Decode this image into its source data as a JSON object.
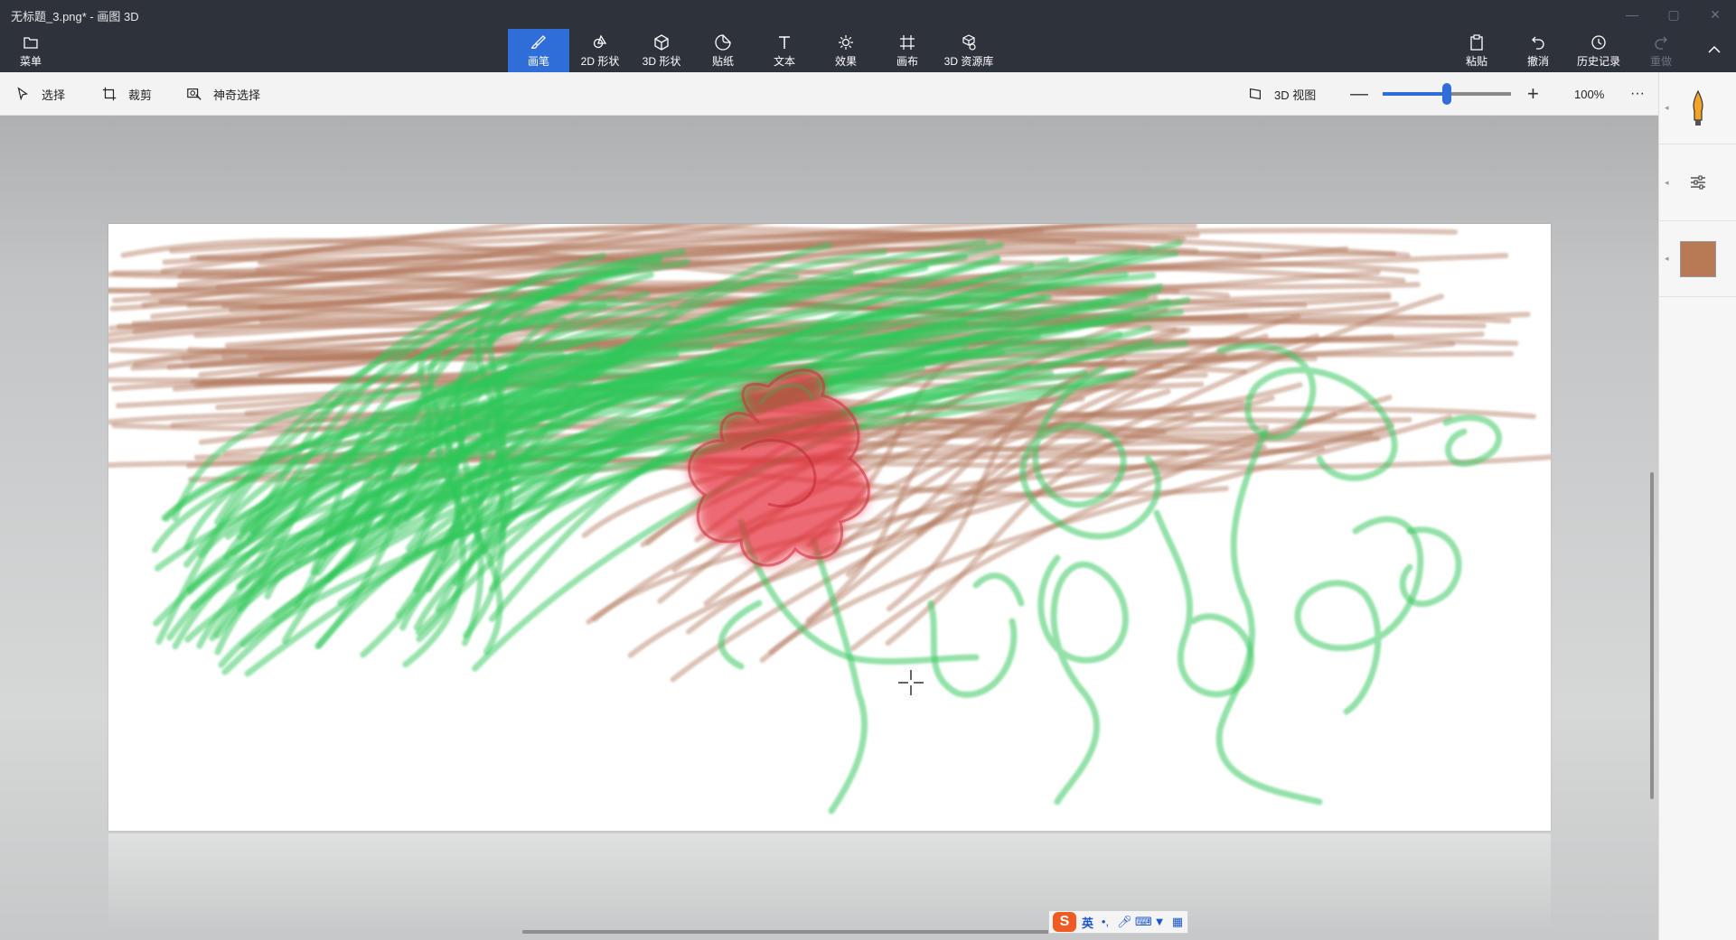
{
  "window": {
    "title": "无标题_3.png* - 画图 3D"
  },
  "menu": {
    "label": "菜单"
  },
  "ribbon": {
    "tabs": [
      {
        "label": "画笔",
        "icon": "brush-icon"
      },
      {
        "label": "2D 形状",
        "icon": "shapes-2d-icon"
      },
      {
        "label": "3D 形状",
        "icon": "cube-icon"
      },
      {
        "label": "贴纸",
        "icon": "sticker-icon"
      },
      {
        "label": "文本",
        "icon": "text-icon"
      },
      {
        "label": "效果",
        "icon": "sun-icon"
      },
      {
        "label": "画布",
        "icon": "canvas-icon"
      },
      {
        "label": "3D 资源库",
        "icon": "library-icon"
      }
    ],
    "active_tab": "画笔",
    "right": {
      "paste": "粘贴",
      "undo": "撤消",
      "history": "历史记录",
      "redo": "重做"
    }
  },
  "toolbar": {
    "select": "选择",
    "crop": "裁剪",
    "magic_select": "神奇选择",
    "view_3d": "3D 视图",
    "zoom_percent": "100%",
    "zoom_level": 0.5,
    "more": "···"
  },
  "side_panel": {
    "tool_icon": "marker-icon",
    "settings_icon": "sliders-icon",
    "color": "#b87a55"
  },
  "ime": {
    "lang": "英",
    "logo": "S"
  },
  "colors": {
    "ribbon_bg": "#2d323b",
    "accent": "#2f6ed8",
    "green_stroke": "#2fc85a",
    "brown_stroke": "#b47a60",
    "red_stroke": "#e62838"
  }
}
